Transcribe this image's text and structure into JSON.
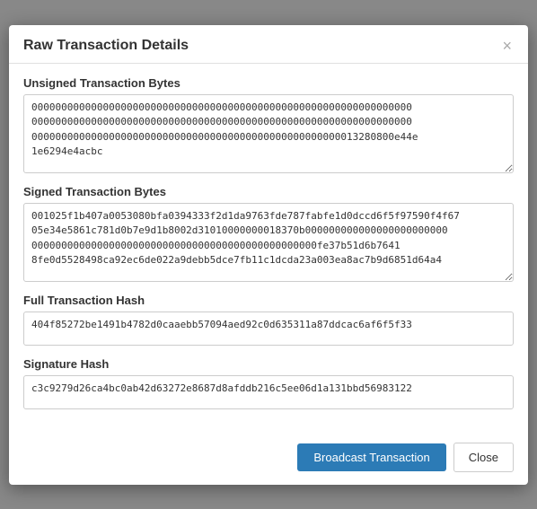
{
  "modal": {
    "title": "Raw Transaction Details",
    "close_x": "×",
    "sections": {
      "unsigned_label": "Unsigned Transaction Bytes",
      "unsigned_value": "0000000000000000000000000000000000000000000000000000000000000000\n0000000000000000000000000000000000000000000000000000000000000000\n0000000000000000000000000000000000000000000000000000013280800e44e\n1e6294e4acbc",
      "signed_label": "Signed Transaction Bytes",
      "signed_value": "001025f1b407a0053080bfa0394333f2d1da9763fde787fabfe1d0dccd6f5f97590f4f67\n05e34e5861c781d0b7e9d1b8002d31010000000018370b000000000000000000000000\n000000000000000000000000000000000000000000000000fe37b51d6b7641\n8fe0d5528498ca92ec6de022a9debb5dce7fb11c1dcda23a003ea8ac7b9d6851d64a4",
      "full_hash_label": "Full Transaction Hash",
      "full_hash_value": "404f85272be1491b4782d0caaebb57094aed92c0d635311a87ddcac6af6f5f33",
      "sig_hash_label": "Signature Hash",
      "sig_hash_value": "c3c9279d26ca4bc0ab42d63272e8687d8afddb216c5ee06d1a131bbd56983122"
    },
    "buttons": {
      "broadcast": "Broadcast Transaction",
      "close": "Close"
    }
  }
}
